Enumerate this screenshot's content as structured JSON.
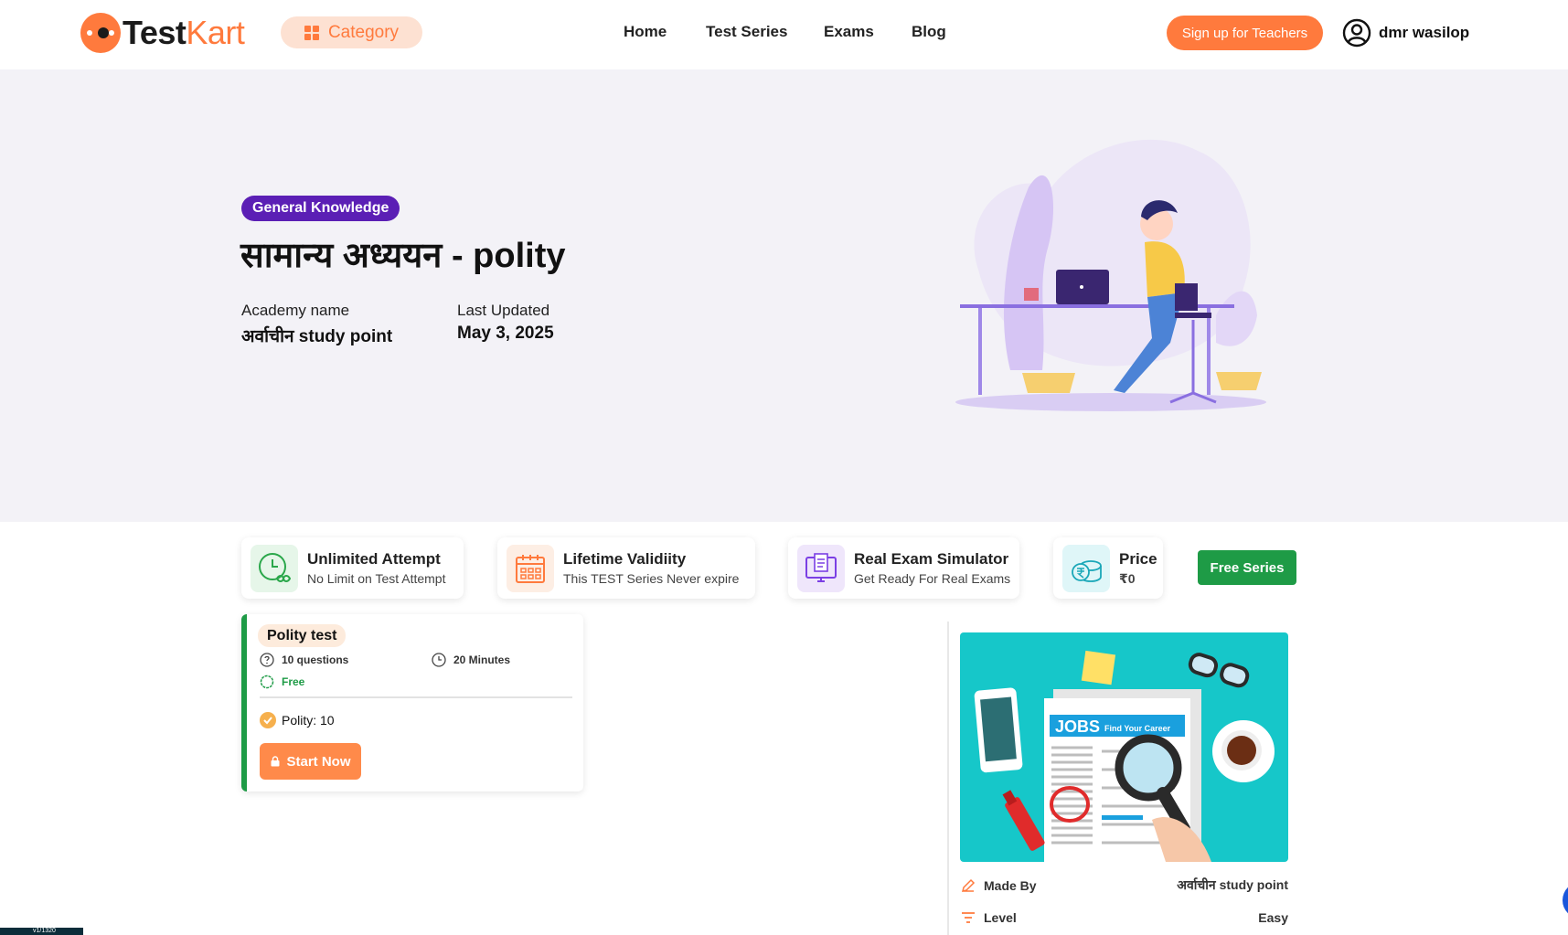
{
  "header": {
    "logo": {
      "part1": "Test",
      "part2": "Kart"
    },
    "category_label": "Category",
    "nav": [
      "Home",
      "Test Series",
      "Exams",
      "Blog"
    ],
    "signup_label": "Sign up for Teachers",
    "user_name": "dmr wasilop"
  },
  "hero": {
    "badge": "General Knowledge",
    "title": "सामान्य अध्ययन - polity",
    "academy_label": "Academy name",
    "academy_value": "अर्वाचीन study point",
    "updated_label": "Last Updated",
    "updated_value": "May 3, 2025"
  },
  "features": [
    {
      "title": "Unlimited Attempt",
      "sub": "No Limit on Test Attempt",
      "icon": "unlimited-clock-icon",
      "color": "#2aa74a",
      "bg": "#e6f6e9"
    },
    {
      "title": "Lifetime Validiity",
      "sub": "This TEST Series Never expire",
      "icon": "calendar-icon",
      "color": "#ff7a3d",
      "bg": "#fdeee4"
    },
    {
      "title": "Real Exam Simulator",
      "sub": "Get Ready For Real Exams",
      "icon": "monitor-exam-icon",
      "color": "#7b3fe4",
      "bg": "#efe6fb"
    },
    {
      "title": "Price",
      "sub": "₹0",
      "icon": "rupee-coin-icon",
      "color": "#1aa7b8",
      "bg": "#dff6f8"
    }
  ],
  "free_series_label": "Free Series",
  "test_card": {
    "name": "Polity test",
    "questions": "10 questions",
    "duration": "20 Minutes",
    "price_tag": "Free",
    "topic": "Polity: 10",
    "start_label": "Start Now"
  },
  "side_card": {
    "image_headline": "JOBS",
    "image_tagline": "Find Your Career",
    "made_by_label": "Made By",
    "made_by_value": "अर्वाचीन study point",
    "level_label": "Level",
    "level_value": "Easy"
  },
  "version_tag": "v1/1320"
}
